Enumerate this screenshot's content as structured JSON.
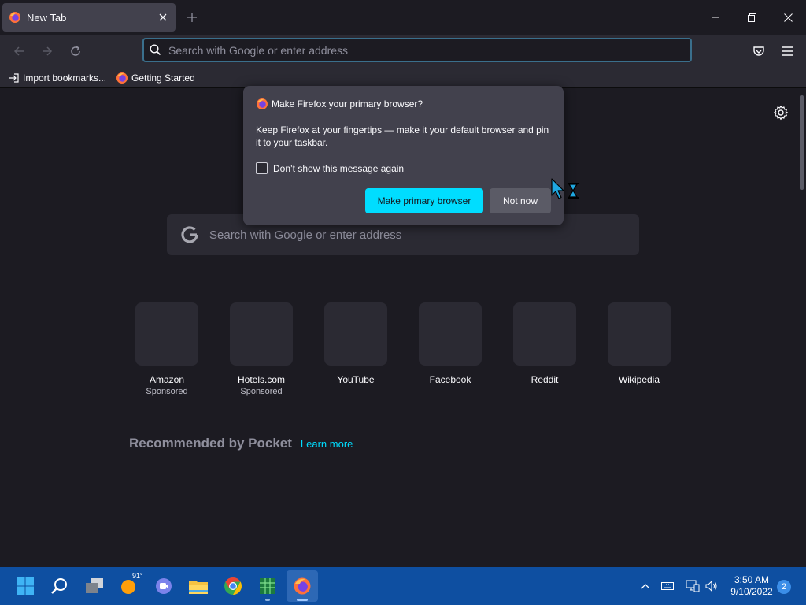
{
  "tab": {
    "title": "New Tab"
  },
  "urlbar": {
    "placeholder": "Search with Google or enter address"
  },
  "bookmarks": [
    {
      "label": "Import bookmarks..."
    },
    {
      "label": "Getting Started"
    }
  ],
  "dialog": {
    "title": "Make Firefox your primary browser?",
    "body": "Keep Firefox at your fingertips — make it your default browser and pin it to your taskbar.",
    "checkbox_label": "Don’t show this message again",
    "primary_button": "Make primary browser",
    "secondary_button": "Not now"
  },
  "newtab": {
    "search_placeholder": "Search with Google or enter address",
    "sites": [
      {
        "name": "Amazon",
        "sponsored": "Sponsored"
      },
      {
        "name": "Hotels.com",
        "sponsored": "Sponsored"
      },
      {
        "name": "YouTube"
      },
      {
        "name": "Facebook"
      },
      {
        "name": "Reddit"
      },
      {
        "name": "Wikipedia"
      }
    ],
    "pocket_heading": "Recommended by Pocket",
    "pocket_link": "Learn more"
  },
  "taskbar": {
    "weather_temp": "91°",
    "time": "3:50 AM",
    "date": "9/10/2022",
    "notifications": "2"
  },
  "colors": {
    "accent": "#00ddff",
    "taskbar": "#0e4fa1",
    "content_bg": "#1c1b22",
    "toolbar_bg": "#2b2a33"
  }
}
